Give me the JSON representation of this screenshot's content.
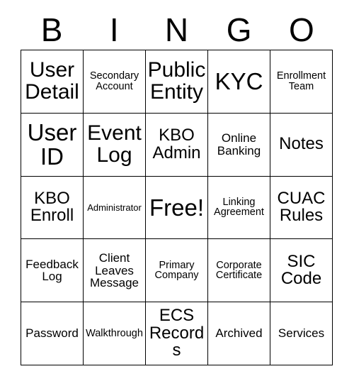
{
  "header": {
    "letters": [
      "B",
      "I",
      "N",
      "G",
      "O"
    ]
  },
  "grid": {
    "rows": [
      [
        {
          "label": "User Detail",
          "size": "fs-lg"
        },
        {
          "label": "Secondary Account",
          "size": "fs-xs"
        },
        {
          "label": "Public Entity",
          "size": "fs-lg"
        },
        {
          "label": "KYC",
          "size": "fs-xl"
        },
        {
          "label": "Enrollment Team",
          "size": "fs-xs"
        }
      ],
      [
        {
          "label": "User ID",
          "size": "fs-xl"
        },
        {
          "label": "Event Log",
          "size": "fs-lg"
        },
        {
          "label": "KBO Admin",
          "size": "fs-md"
        },
        {
          "label": "Online Banking",
          "size": "fs-sm"
        },
        {
          "label": "Notes",
          "size": "fs-md"
        }
      ],
      [
        {
          "label": "KBO Enroll",
          "size": "fs-md"
        },
        {
          "label": "Administrator",
          "size": "fs-xxs"
        },
        {
          "label": "Free!",
          "size": "fs-xl"
        },
        {
          "label": "Linking Agreement",
          "size": "fs-xs"
        },
        {
          "label": "CUAC Rules",
          "size": "fs-md"
        }
      ],
      [
        {
          "label": "Feedback Log",
          "size": "fs-sm"
        },
        {
          "label": "Client Leaves Message",
          "size": "fs-sm"
        },
        {
          "label": "Primary Company",
          "size": "fs-xs"
        },
        {
          "label": "Corporate Certificate",
          "size": "fs-xs"
        },
        {
          "label": "SIC Code",
          "size": "fs-md"
        }
      ],
      [
        {
          "label": "Password",
          "size": "fs-sm"
        },
        {
          "label": "Walkthrough",
          "size": "fs-xs"
        },
        {
          "label": "ECS Records",
          "size": "fs-md"
        },
        {
          "label": "Archived",
          "size": "fs-sm"
        },
        {
          "label": "Services",
          "size": "fs-sm"
        }
      ]
    ]
  },
  "colors": {
    "background": "#ffffff",
    "text": "#000000",
    "border": "#000000"
  }
}
